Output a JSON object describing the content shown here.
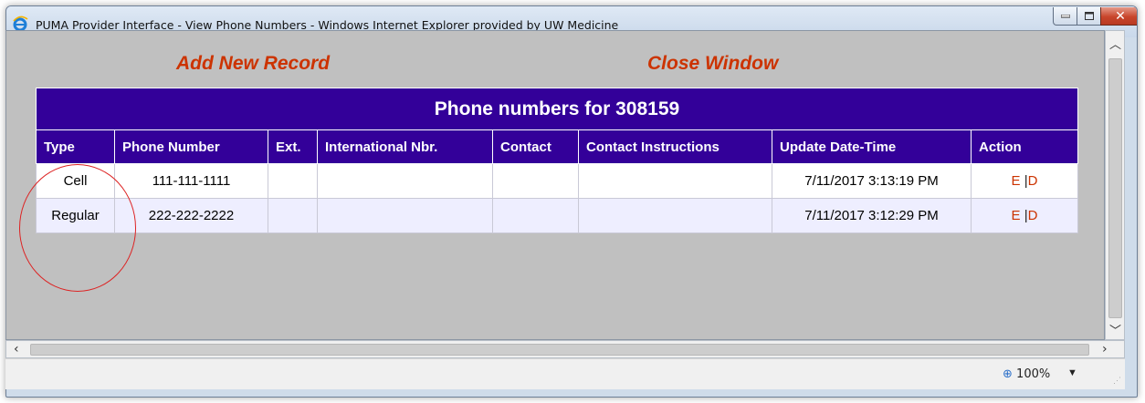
{
  "window": {
    "title": "PUMA Provider Interface - View Phone Numbers - Windows Internet Explorer provided by UW Medicine"
  },
  "links": {
    "add": "Add New Record",
    "close": "Close Window"
  },
  "table": {
    "caption": "Phone numbers for 308159",
    "columns": [
      "Type",
      "Phone Number",
      "Ext.",
      "International Nbr.",
      "Contact",
      "Contact Instructions",
      "Update Date-Time",
      "Action"
    ],
    "rows": [
      {
        "type": "Cell",
        "phone": "111-111-1111",
        "ext": "",
        "intl": "",
        "contact": "",
        "instructions": "",
        "updated": "7/11/2017 3:13:19 PM",
        "action_edit": "E",
        "action_sep": "|",
        "action_delete": "D"
      },
      {
        "type": "Regular",
        "phone": "222-222-2222",
        "ext": "",
        "intl": "",
        "contact": "",
        "instructions": "",
        "updated": "7/11/2017 3:12:29 PM",
        "action_edit": "E",
        "action_sep": "|",
        "action_delete": "D"
      }
    ]
  },
  "status": {
    "zoom": "100%"
  },
  "icons": {
    "browser": "ie-logo-icon",
    "minimize": "minimize-icon",
    "maximize": "maximize-icon",
    "close": "close-icon",
    "zoom": "zoom-icon"
  },
  "colors": {
    "header_bg": "#330099",
    "link": "#cc3300",
    "row_alt": "#eeeeff",
    "content_bg": "#c0c0c0",
    "annotation": "#dd2222"
  }
}
